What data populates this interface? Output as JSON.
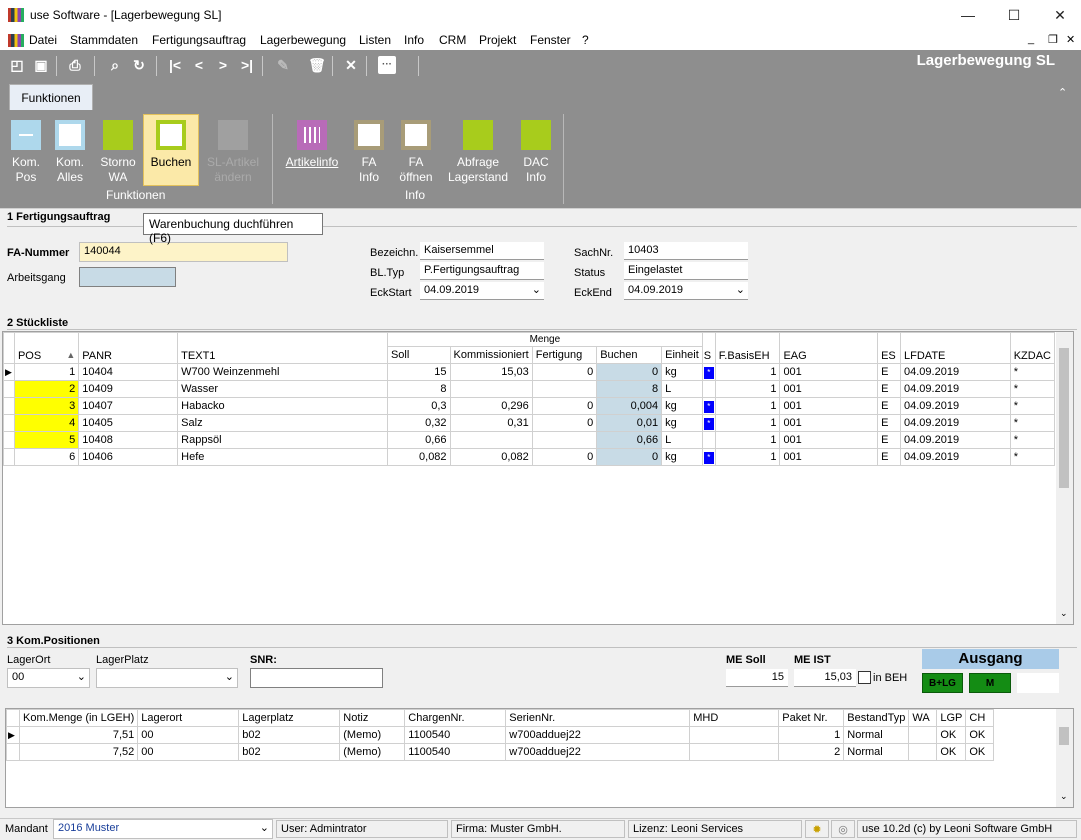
{
  "window": {
    "title": "use Software - [Lagerbewegung SL]",
    "min": "—",
    "max": "☐",
    "close": "✕"
  },
  "menu": [
    "Datei",
    "Stammdaten",
    "Fertigungsauftrag",
    "Lagerbewegung",
    "Listen",
    "Info",
    "CRM",
    "Projekt",
    "Fenster",
    "?"
  ],
  "toolbar": {
    "form_title": "Lagerbewegung SL"
  },
  "ribbon": {
    "tab": "Funktionen",
    "buttons": [
      {
        "l1": "Kom.",
        "l2": "Pos",
        "color": "#aed8ec"
      },
      {
        "l1": "Kom.",
        "l2": "Alles",
        "color": "#aed8ec"
      },
      {
        "l1": "Storno",
        "l2": "WA",
        "color": "#a8cc1c"
      },
      {
        "l1": "Buchen",
        "l2": "",
        "color": "#a8cc1c"
      },
      {
        "l1": "SL-Artikel",
        "l2": "ändern",
        "color": "#bdbdbd"
      },
      {
        "l1": "Artikelinfo",
        "l2": "",
        "color": "#b86bb8"
      },
      {
        "l1": "FA",
        "l2": "Info",
        "color": "#a89c78"
      },
      {
        "l1": "FA",
        "l2": "öffnen",
        "color": "#a89c78"
      },
      {
        "l1": "Abfrage",
        "l2": "Lagerstand",
        "color": "#a8cc1c"
      },
      {
        "l1": "DAC",
        "l2": "Info",
        "color": "#a8cc1c"
      }
    ],
    "group1": "Funktionen",
    "group2": "Info",
    "tooltip": "Warenbuchung duchführen (F6)"
  },
  "fa": {
    "section": "1 Fertigungsauftrag",
    "fa_label": "FA-Nummer",
    "fa_value": "140044",
    "ag_label": "Arbeitsgang",
    "bez_label": "Bezeichn.",
    "bez_value": "Kaisersemmel",
    "bltyp_label": "BL.Typ",
    "bltyp_value": "P.Fertigungsauftrag",
    "eckstart_label": "EckStart",
    "eckstart_value": "04.09.2019",
    "sachnr_label": "SachNr.",
    "sachnr_value": "10403",
    "status_label": "Status",
    "status_value": "Eingelastet",
    "eckend_label": "EckEnd",
    "eckend_value": "04.09.2019"
  },
  "sl": {
    "section": "2 Stückliste",
    "group_header": "Menge",
    "headers": [
      "POS",
      "PANR",
      "TEXT1",
      "Soll",
      "Kommissioniert",
      "Fertigung",
      "Buchen",
      "Einheit",
      "S",
      "F.BasisEH",
      "EAG",
      "ES",
      "LFDATE",
      "KZDAC"
    ],
    "rows": [
      [
        "1",
        "10404",
        "W700 Weinzenmehl",
        "15",
        "15,03",
        "0",
        "0",
        "kg",
        "*",
        "1",
        "001",
        "E",
        "04.09.2019",
        "*"
      ],
      [
        "2",
        "10409",
        "Wasser",
        "8",
        "",
        "",
        "8",
        "L",
        "",
        "1",
        "001",
        "E",
        "04.09.2019",
        "*"
      ],
      [
        "3",
        "10407",
        "Habacko",
        "0,3",
        "0,296",
        "0",
        "0,004",
        "kg",
        "*",
        "1",
        "001",
        "E",
        "04.09.2019",
        "*"
      ],
      [
        "4",
        "10405",
        "Salz",
        "0,32",
        "0,31",
        "0",
        "0,01",
        "kg",
        "*",
        "1",
        "001",
        "E",
        "04.09.2019",
        "*"
      ],
      [
        "5",
        "10408",
        "Rappsöl",
        "0,66",
        "",
        "",
        "0,66",
        "L",
        "",
        "1",
        "001",
        "E",
        "04.09.2019",
        "*"
      ],
      [
        "6",
        "10406",
        "Hefe",
        "0,082",
        "0,082",
        "0",
        "0",
        "kg",
        "*",
        "1",
        "001",
        "E",
        "04.09.2019",
        "*"
      ]
    ]
  },
  "kom": {
    "section": "3 Kom.Positionen",
    "lagerort_label": "LagerOrt",
    "lagerort_value": "00",
    "lagerplatz_label": "LagerPlatz",
    "lagerplatz_value": "",
    "snr_label": "SNR:",
    "mesoll_label": "ME Soll",
    "mesoll_value": "15",
    "meist_label": "ME IST",
    "meist_value": "15,03",
    "inbeh_label": "in BEH",
    "ausgang": "Ausgang",
    "btn_blg": "B+LG",
    "btn_m": "M",
    "headers": [
      "Kom.Menge (in LGEH)",
      "Lagerort",
      "Lagerplatz",
      "Notiz",
      "ChargenNr.",
      "SerienNr.",
      "MHD",
      "Paket Nr.",
      "BestandTyp",
      "WA",
      "LGP",
      "CH"
    ],
    "rows": [
      [
        "7,51",
        "00",
        "b02",
        "(Memo)",
        "1100540",
        "w700adduej22",
        "",
        "1",
        "Normal",
        "",
        "OK",
        "OK"
      ],
      [
        "7,52",
        "00",
        "b02",
        "(Memo)",
        "1100540",
        "w700adduej22",
        "",
        "2",
        "Normal",
        "",
        "OK",
        "OK"
      ]
    ]
  },
  "statusbar": {
    "mandant_label": "Mandant",
    "mandant_value": "2016 Muster",
    "user": "User: Admintrator",
    "firma": "Firma: Muster GmbH.",
    "lizenz": "Lizenz: Leoni Services",
    "version": "use 10.2d (c) by Leoni Software GmbH"
  }
}
